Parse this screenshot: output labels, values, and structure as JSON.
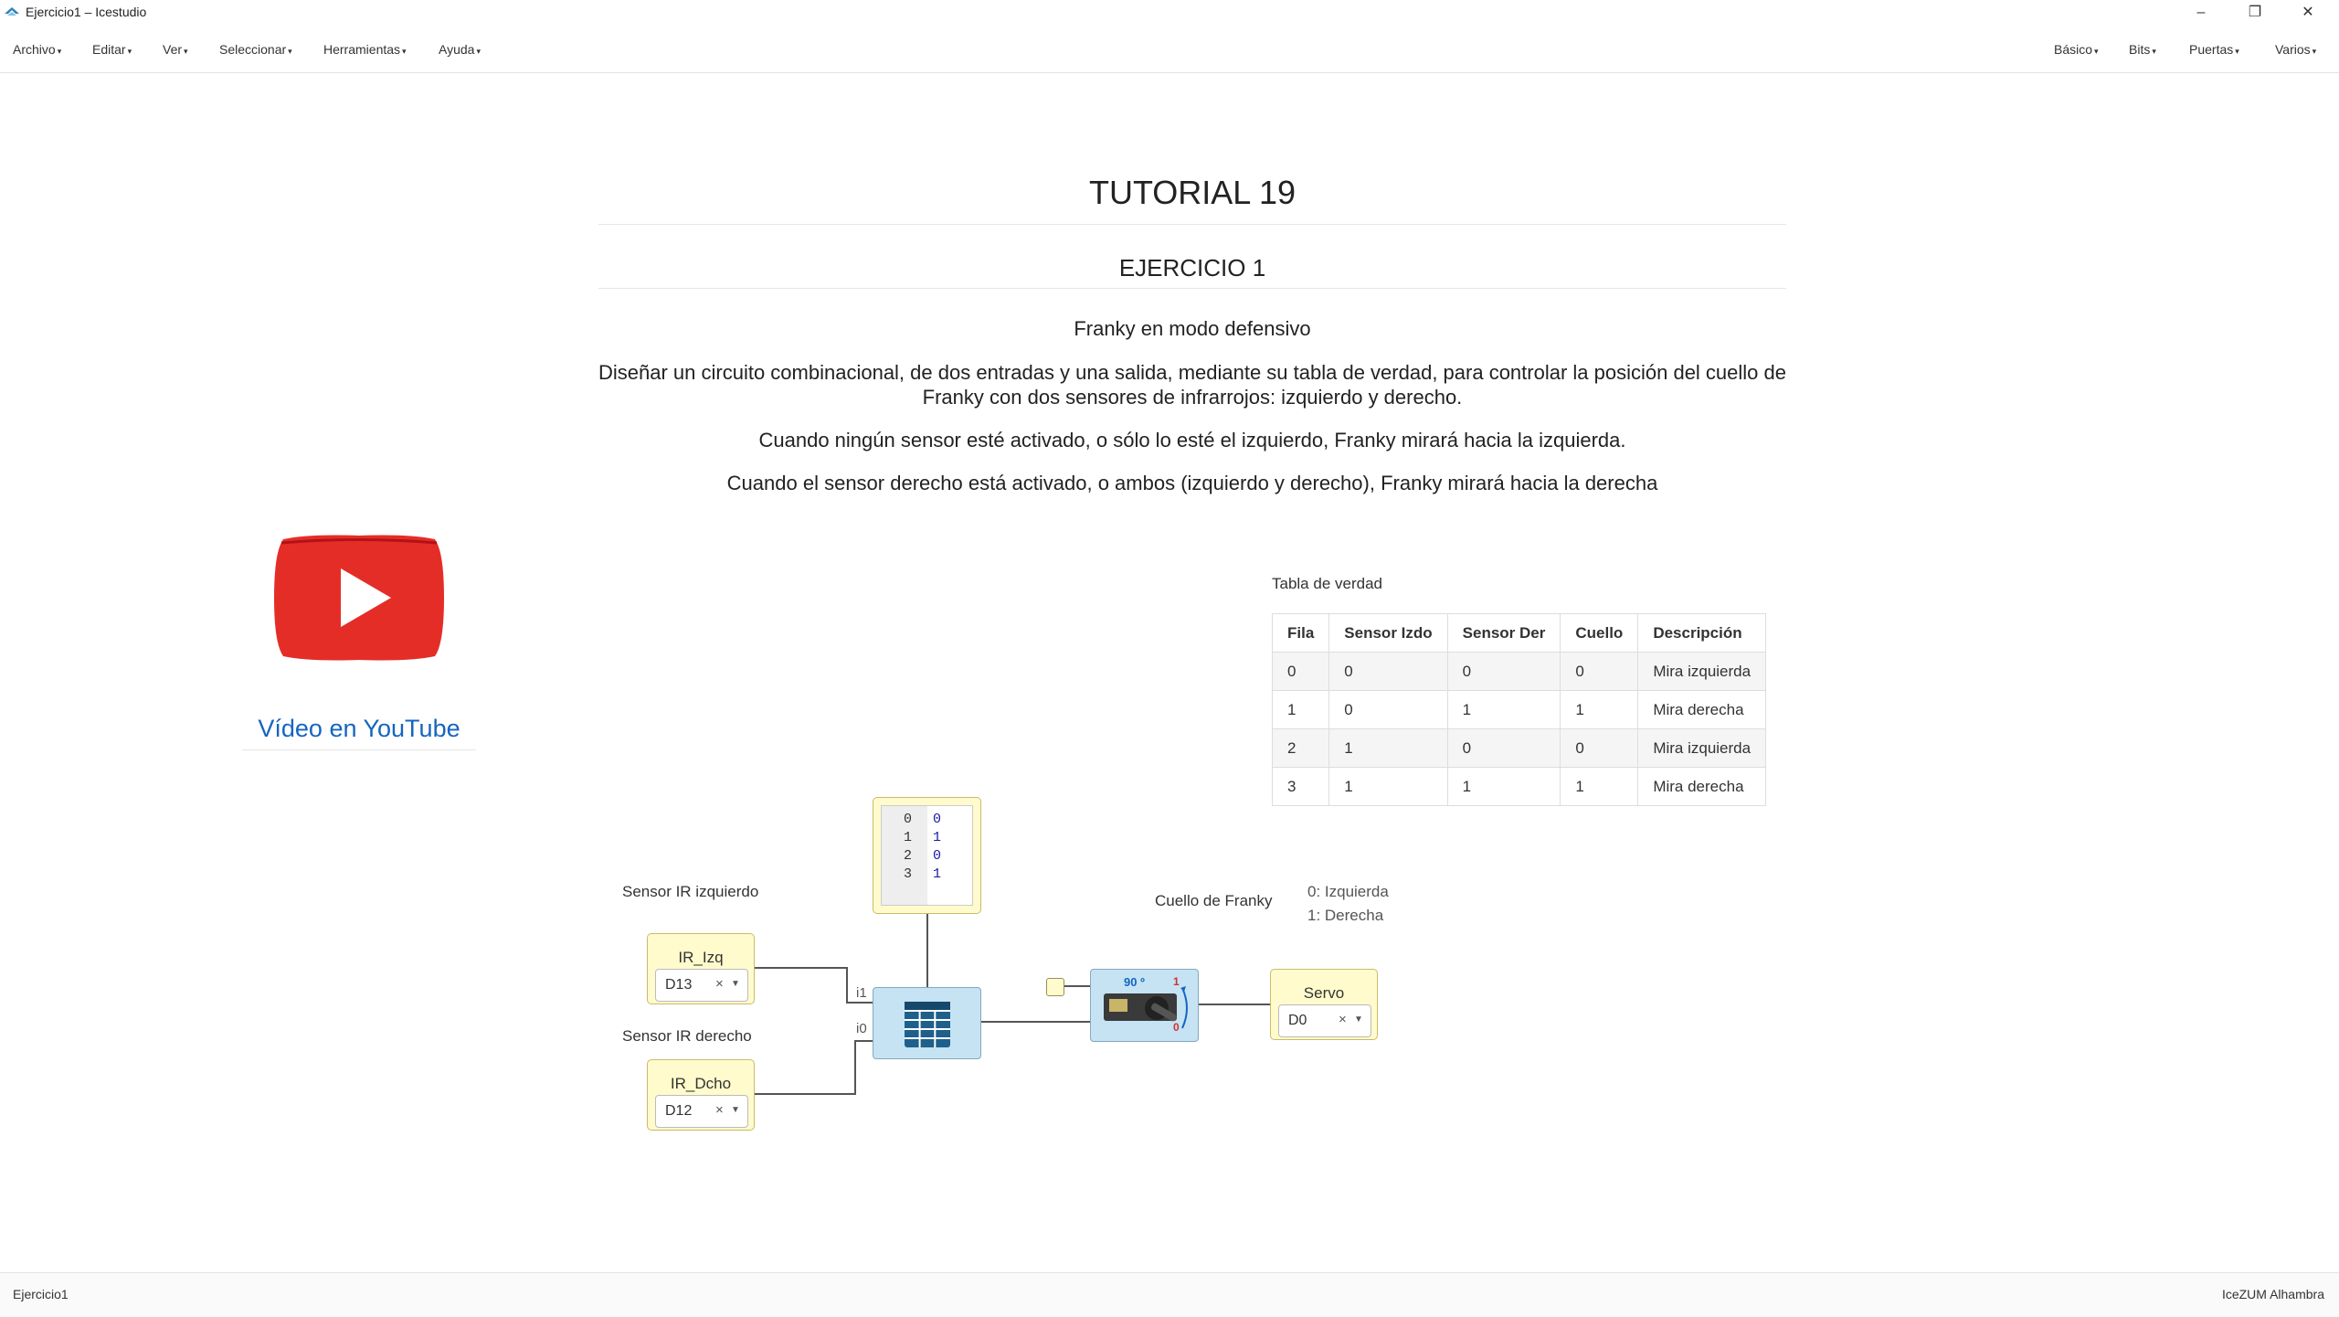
{
  "window": {
    "title": "Ejercicio1 – Icestudio"
  },
  "menu_left": [
    "Archivo",
    "Editar",
    "Ver",
    "Seleccionar",
    "Herramientas",
    "Ayuda"
  ],
  "menu_right": [
    "Básico",
    "Bits",
    "Puertas",
    "Varios"
  ],
  "doc": {
    "title": "TUTORIAL 19",
    "subtitle": "EJERCICIO 1",
    "heading": "Franky en modo defensivo",
    "p1": "Diseñar un circuito combinacional, de dos entradas y una salida, mediante su tabla de verdad, para controlar la posición del cuello de Franky con dos sensores de infrarrojos: izquierdo y derecho.",
    "p2": "Cuando ningún sensor esté activado, o sólo lo esté el izquierdo, Franky mirará hacia la izquierda.",
    "p3": "Cuando el sensor derecho está activado, o ambos (izquierdo y derecho), Franky mirará hacia la derecha"
  },
  "youtube": {
    "link": "Vídeo en YouTube",
    "icon": "youtube-play-icon"
  },
  "truth_table": {
    "title": "Tabla de verdad",
    "headers": [
      "Fila",
      "Sensor Izdo",
      "Sensor Der",
      "Cuello",
      "Descripción"
    ],
    "rows": [
      [
        "0",
        "0",
        "0",
        "0",
        "Mira izquierda"
      ],
      [
        "1",
        "0",
        "1",
        "1",
        "Mira derecha"
      ],
      [
        "2",
        "1",
        "0",
        "0",
        "Mira izquierda"
      ],
      [
        "3",
        "1",
        "1",
        "1",
        "Mira derecha"
      ]
    ]
  },
  "circuit": {
    "label_left_sensor": "Sensor IR izquierdo",
    "label_right_sensor": "Sensor IR derecho",
    "label_neck": "Cuello de Franky",
    "neck_note_0": "0: Izquierda",
    "neck_note_1": "1: Derecha",
    "ir_izq": {
      "name": "IR_Izq",
      "pin": "D13"
    },
    "ir_dcho": {
      "name": "IR_Dcho",
      "pin": "D12"
    },
    "servo": {
      "name": "Servo",
      "pin": "D0"
    },
    "port_i1": "i1",
    "port_i0": "i0",
    "memory_index": [
      "0",
      "1",
      "2",
      "3"
    ],
    "memory_values": [
      "0",
      "1",
      "0",
      "1"
    ],
    "servo_angle": "90 º",
    "servo_hi": "1",
    "servo_lo": "0"
  },
  "status": {
    "left": "Ejercicio1",
    "right": "IceZUM Alhambra"
  }
}
